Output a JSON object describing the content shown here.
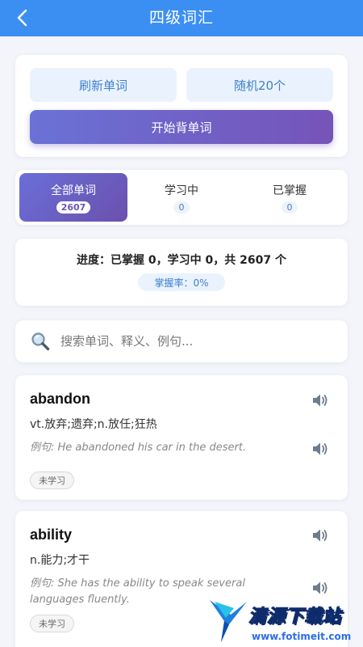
{
  "header": {
    "title": "四级词汇"
  },
  "actions": {
    "refresh_label": "刷新单词",
    "random_label": "随机20个",
    "start_label": "开始背单词"
  },
  "tabs": [
    {
      "label": "全部单词",
      "count": "2607",
      "active": true
    },
    {
      "label": "学习中",
      "count": "0",
      "active": false
    },
    {
      "label": "已掌握",
      "count": "0",
      "active": false
    }
  ],
  "progress": {
    "summary": "进度：已掌握 0，学习中 0，共 2607 个",
    "mastery_rate": "掌握率：0%"
  },
  "search": {
    "placeholder": "搜索单词、释义、例句..."
  },
  "words": [
    {
      "word": "abandon",
      "definition": "vt.放弃;遗弃;n.放任;狂热",
      "example_prefix": "例句:",
      "example": "He abandoned his car in the desert.",
      "status": "未学习"
    },
    {
      "word": "ability",
      "definition": "n.能力;才干",
      "example_prefix": "例句:",
      "example": "She has the ability to speak several languages fluently.",
      "status": "未学习"
    }
  ],
  "watermark": {
    "text": "清源下载站",
    "url": "www.fotimeit.com"
  },
  "colors": {
    "header": "#3b8ff3",
    "accent_purple": "#6b55b5",
    "light_button": "#eaf3fd",
    "light_button_text": "#3f7fcf"
  }
}
